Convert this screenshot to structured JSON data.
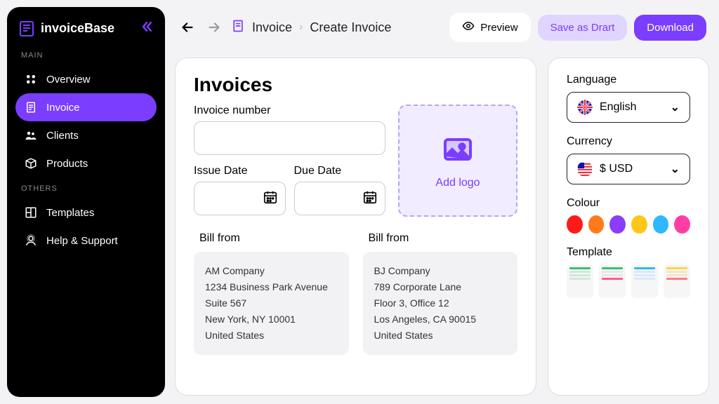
{
  "brand": {
    "name": "invoiceBase"
  },
  "sidebar": {
    "sections": [
      {
        "label": "MAIN",
        "items": [
          {
            "label": "Overview",
            "icon": "grid-icon"
          },
          {
            "label": "Invoice",
            "icon": "invoice-icon",
            "active": true
          },
          {
            "label": "Clients",
            "icon": "clients-icon"
          },
          {
            "label": "Products",
            "icon": "products-icon"
          }
        ]
      },
      {
        "label": "OTHERS",
        "items": [
          {
            "label": "Templates",
            "icon": "templates-icon"
          },
          {
            "label": "Help & Support",
            "icon": "help-icon"
          }
        ]
      }
    ]
  },
  "breadcrumb": {
    "current": "Invoice",
    "child": "Create Invoice"
  },
  "actions": {
    "preview": "Preview",
    "draft": "Save as Drart",
    "download": "Download"
  },
  "invoice": {
    "heading": "Invoices",
    "number_label": "Invoice number",
    "number_value": "",
    "issue_label": "Issue Date",
    "due_label": "Due Date",
    "logo_label": "Add logo",
    "bill_from_label": "Bill from",
    "bill_to_label": "Bill from",
    "bill_from": {
      "company": "AM Company",
      "line1": "1234 Business Park Avenue",
      "line2": "Suite 567",
      "city": "New York, NY 10001",
      "country": "United States"
    },
    "bill_to": {
      "company": "BJ Company",
      "line1": "789 Corporate Lane",
      "line2": "Floor 3, Office 12",
      "city": "Los Angeles, CA 90015",
      "country": "United States"
    }
  },
  "settings": {
    "language_label": "Language",
    "language_value": "English",
    "currency_label": "Currency",
    "currency_value": "$ USD",
    "colour_label": "Colour",
    "colours": [
      "#ff1a1a",
      "#ff7a1a",
      "#8a3dff",
      "#ffc61a",
      "#2fb8ff",
      "#ff3ea5"
    ],
    "template_label": "Template",
    "templates": [
      {
        "accent": "#36c26b",
        "bars": [
          "#36c26b",
          "#cfe9d8",
          "#cfe9d8",
          "#cfe9d8"
        ]
      },
      {
        "accent": "#ff5b8a",
        "bars": [
          "#36c26b",
          "#e7e7e7",
          "#e7e7e7",
          "#ff5b8a"
        ]
      },
      {
        "accent": "#36c26b",
        "bars": [
          "#2fb8ff",
          "#d7e9ff",
          "#d7e9ff",
          "#d7e9ff"
        ]
      },
      {
        "accent": "#ffd24a",
        "bars": [
          "#ffd24a",
          "#f1e7c4",
          "#f1e7c4",
          "#ff7a8a"
        ]
      }
    ]
  }
}
